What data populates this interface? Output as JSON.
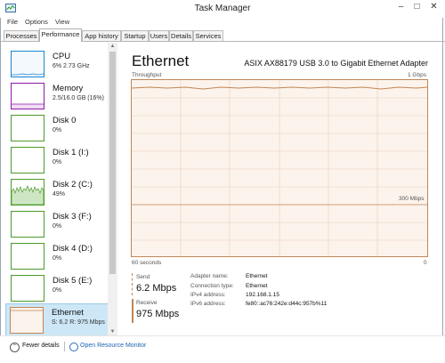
{
  "window": {
    "title": "Task Manager",
    "controls": {
      "minimize": "–",
      "maximize": "□",
      "close": "✕"
    }
  },
  "menu": {
    "items": [
      "File",
      "Options",
      "View"
    ]
  },
  "tabs": [
    {
      "label": "Processes",
      "active": false
    },
    {
      "label": "Performance",
      "active": true
    },
    {
      "label": "App history",
      "active": false
    },
    {
      "label": "Startup",
      "active": false
    },
    {
      "label": "Users",
      "active": false
    },
    {
      "label": "Details",
      "active": false
    },
    {
      "label": "Services",
      "active": false
    }
  ],
  "sidebar": {
    "items": [
      {
        "name": "CPU",
        "sub": "6% 2.73 GHz",
        "color": "#1a85d0",
        "selected": false
      },
      {
        "name": "Memory",
        "sub": "2.5/16.0 GB (16%)",
        "color": "#8b1aa8",
        "selected": false
      },
      {
        "name": "Disk 0",
        "sub": "0%",
        "color": "#4c9a2a",
        "selected": false
      },
      {
        "name": "Disk 1 (I:)",
        "sub": "0%",
        "color": "#4c9a2a",
        "selected": false
      },
      {
        "name": "Disk 2 (C:)",
        "sub": "49%",
        "color": "#4c9a2a",
        "selected": false
      },
      {
        "name": "Disk 3 (F:)",
        "sub": "0%",
        "color": "#4c9a2a",
        "selected": false
      },
      {
        "name": "Disk 4 (D:)",
        "sub": "0%",
        "color": "#4c9a2a",
        "selected": false
      },
      {
        "name": "Disk 5 (E:)",
        "sub": "0%",
        "color": "#4c9a2a",
        "selected": false
      },
      {
        "name": "Ethernet",
        "sub": "S: 6.2  R: 975 Mbps",
        "color": "#c28656",
        "selected": true
      }
    ]
  },
  "main": {
    "title": "Ethernet",
    "adapter": "ASIX AX88179 USB 3.0 to Gigabit Ethernet Adapter",
    "throughput_label": "Throughput",
    "max_label": "1 Gbps",
    "mid_label": "300 Mbps",
    "time_label": "60 seconds",
    "zero_label": "0",
    "send": {
      "label": "Send",
      "value": "6.2 Mbps"
    },
    "receive": {
      "label": "Receive",
      "value": "975 Mbps"
    },
    "properties": [
      {
        "key": "Adapter name:",
        "value": "Ethernet"
      },
      {
        "key": "Connection type:",
        "value": "Ethernet"
      },
      {
        "key": "IPv4 address:",
        "value": "192.168.1.15"
      },
      {
        "key": "IPv6 address:",
        "value": "fe80::ac76:242e:d44c:957b%11"
      }
    ]
  },
  "footer": {
    "fewer_details": "Fewer details",
    "open_resource_monitor": "Open Resource Monitor"
  },
  "colors": {
    "ethernet": "#c28656",
    "cpu": "#1a85d0",
    "memory": "#8b1aa8",
    "disk": "#4c9a2a",
    "link": "#1e62b0"
  }
}
